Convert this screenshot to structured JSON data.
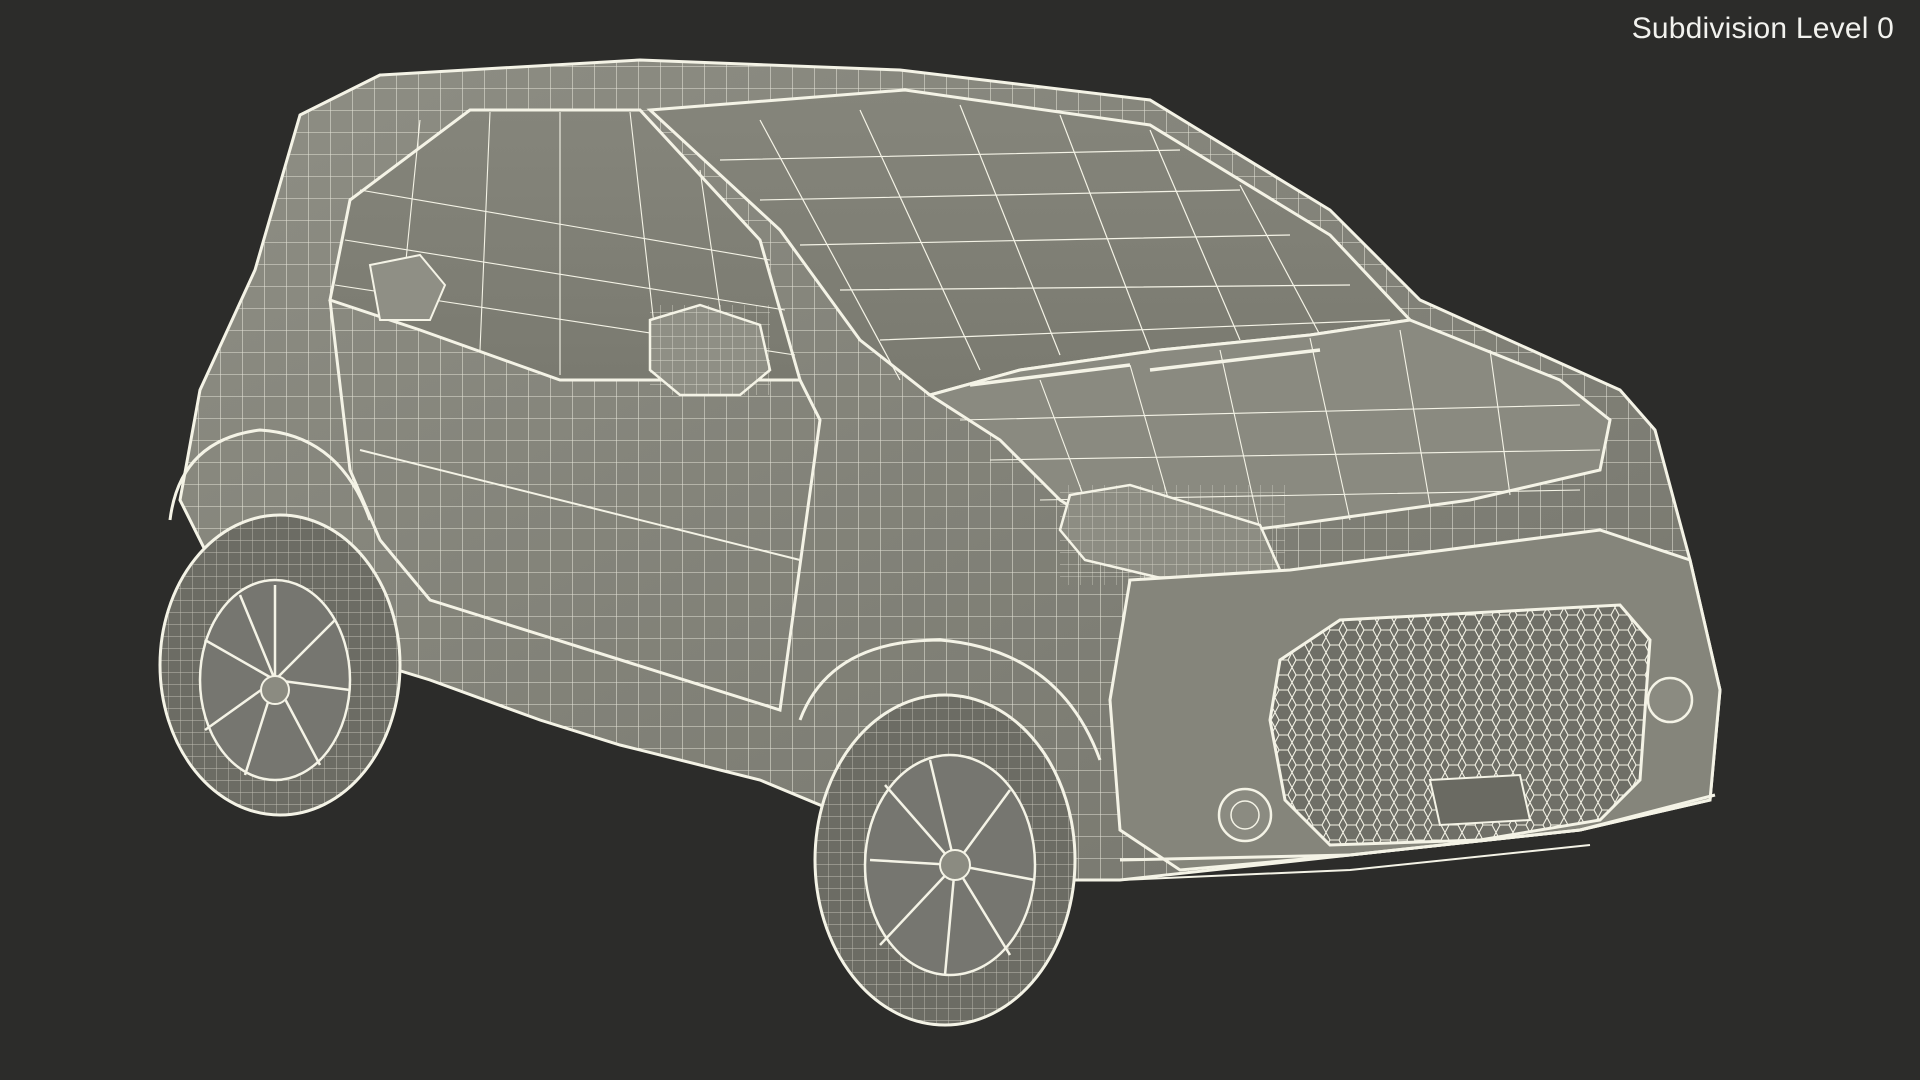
{
  "viewport": {
    "label": "Subdivision Level 0",
    "background_color": "#2c2c2a",
    "model_fill_color": "#8b8b80",
    "wire_color": "#f4f3e6"
  }
}
